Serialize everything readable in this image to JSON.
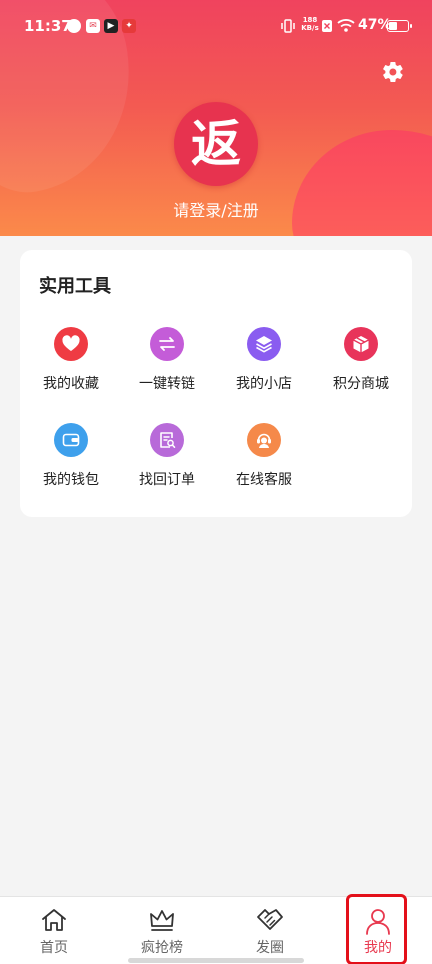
{
  "status_bar": {
    "time": "11:37",
    "net_speed_value": "188",
    "net_speed_unit": "KB/s",
    "battery_percent": "47%",
    "battery_level": 0.47
  },
  "header": {
    "avatar_glyph": "返",
    "login_text": "请登录/注册"
  },
  "tools": {
    "title": "实用工具",
    "items": [
      {
        "label": "我的收藏",
        "icon": "heart-icon",
        "color": "#ef3b43"
      },
      {
        "label": "一键转链",
        "icon": "convert-arrows-icon",
        "color": "#c45cd8"
      },
      {
        "label": "我的小店",
        "icon": "layers-icon",
        "color": "#8a5cf0"
      },
      {
        "label": "积分商城",
        "icon": "gift-box-icon",
        "color": "#e8345a"
      },
      {
        "label": "我的钱包",
        "icon": "wallet-icon",
        "color": "#3ea0ec"
      },
      {
        "label": "找回订单",
        "icon": "order-search-icon",
        "color": "#b86ad9"
      },
      {
        "label": "在线客服",
        "icon": "customer-service-icon",
        "color": "#f5894a"
      }
    ]
  },
  "bottom_nav": {
    "items": [
      {
        "label": "首页",
        "icon": "home-icon"
      },
      {
        "label": "疯抢榜",
        "icon": "crown-icon"
      },
      {
        "label": "发圈",
        "icon": "handshake-icon"
      },
      {
        "label": "我的",
        "icon": "person-icon"
      }
    ],
    "active_index": 3,
    "active_color": "#e8394f"
  }
}
